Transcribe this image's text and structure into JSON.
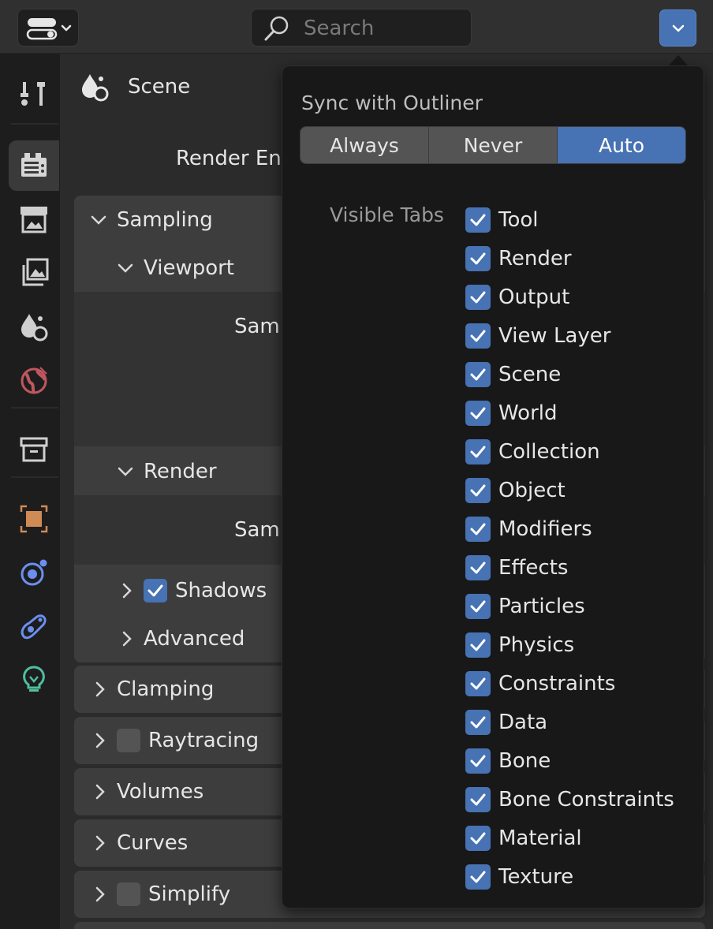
{
  "header": {
    "search_placeholder": "Search"
  },
  "context": {
    "label": "Scene"
  },
  "properties": {
    "render_engine_label": "Render Eng",
    "sampling": "Sampling",
    "viewport": "Viewport",
    "viewport_samples_label": "Samp",
    "render": "Render",
    "render_samples_label": "Samp",
    "shadows": "Shadows",
    "advanced": "Advanced",
    "clamping": "Clamping",
    "raytracing": "Raytracing",
    "volumes": "Volumes",
    "curves": "Curves",
    "simplify": "Simplify"
  },
  "popup": {
    "sync_title": "Sync with Outliner",
    "sync_options": [
      "Always",
      "Never",
      "Auto"
    ],
    "sync_selected": "Auto",
    "visible_tabs_label": "Visible Tabs",
    "visible_tabs": [
      {
        "label": "Tool",
        "checked": true
      },
      {
        "label": "Render",
        "checked": true
      },
      {
        "label": "Output",
        "checked": true
      },
      {
        "label": "View Layer",
        "checked": true
      },
      {
        "label": "Scene",
        "checked": true
      },
      {
        "label": "World",
        "checked": true
      },
      {
        "label": "Collection",
        "checked": true
      },
      {
        "label": "Object",
        "checked": true
      },
      {
        "label": "Modifiers",
        "checked": true
      },
      {
        "label": "Effects",
        "checked": true
      },
      {
        "label": "Particles",
        "checked": true
      },
      {
        "label": "Physics",
        "checked": true
      },
      {
        "label": "Constraints",
        "checked": true
      },
      {
        "label": "Data",
        "checked": true
      },
      {
        "label": "Bone",
        "checked": true
      },
      {
        "label": "Bone Constraints",
        "checked": true
      },
      {
        "label": "Material",
        "checked": true
      },
      {
        "label": "Texture",
        "checked": true
      }
    ]
  },
  "colors": {
    "accent": "#4772b3",
    "world_icon": "#c0575f",
    "collection_icon": "#d08a54",
    "object_icon": "#6b8ff0",
    "light_icon": "#4fbfa0"
  }
}
